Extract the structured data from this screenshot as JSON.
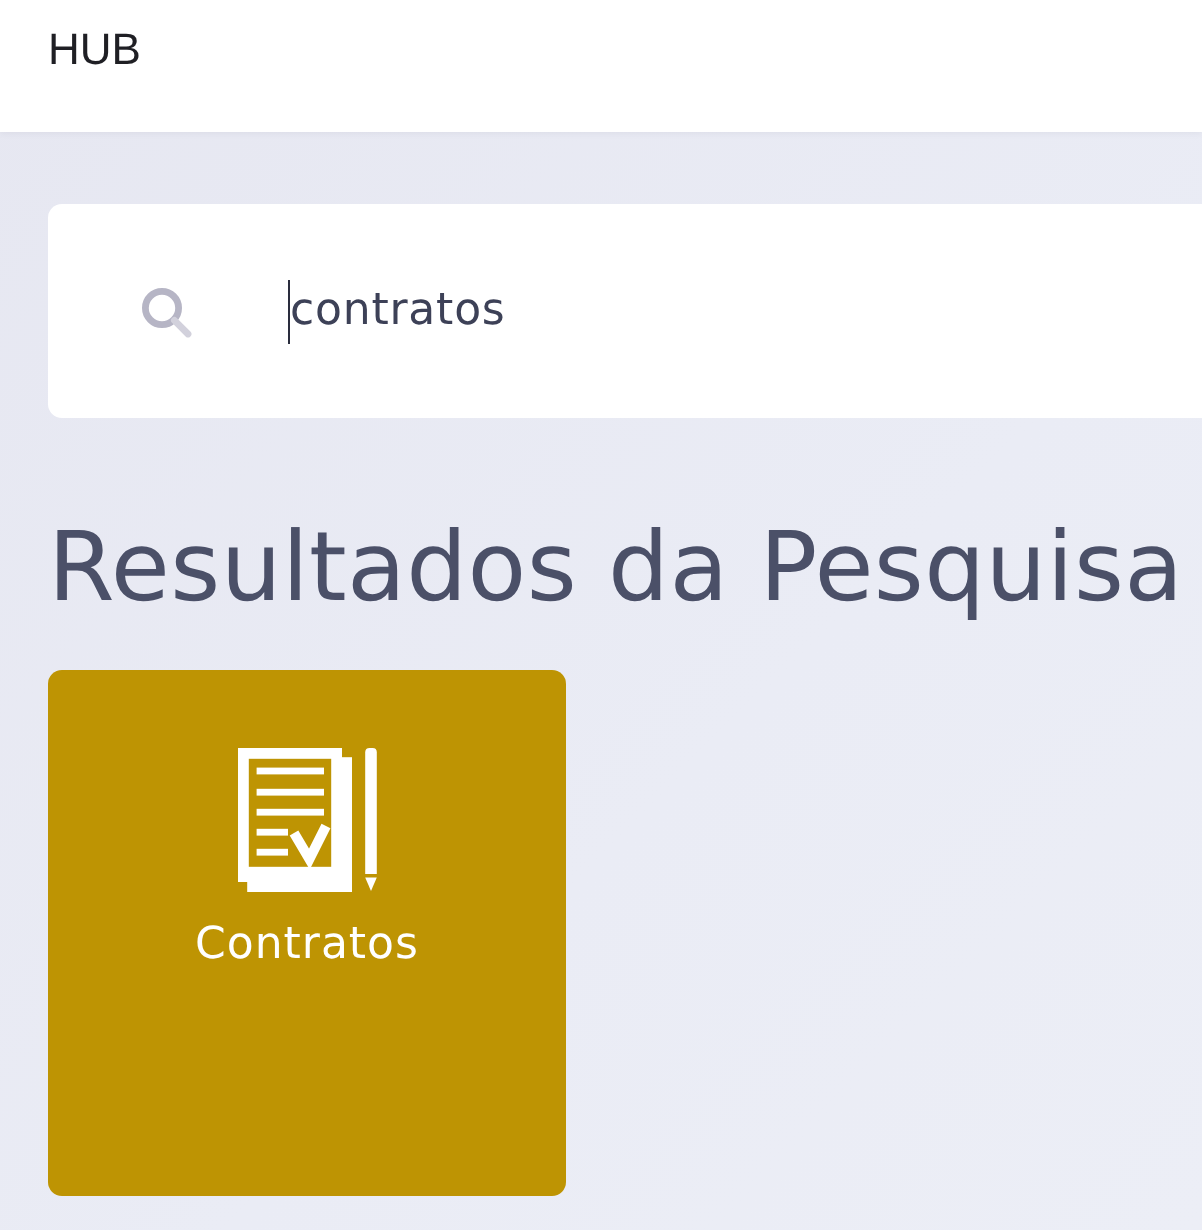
{
  "header": {
    "title": "HUB"
  },
  "search": {
    "value": "contratos",
    "focused": true
  },
  "results": {
    "title": "Resultados da Pesquisa",
    "items": [
      {
        "label": "Contratos"
      }
    ]
  }
}
